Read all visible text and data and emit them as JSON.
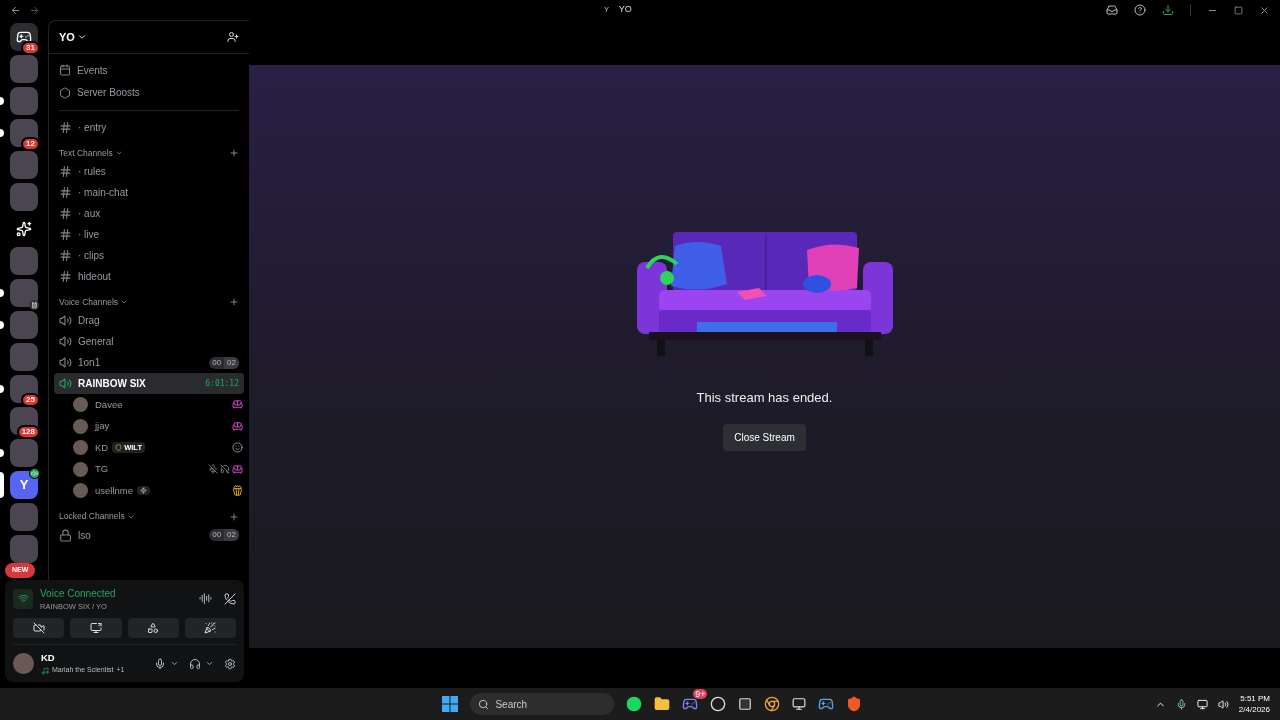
{
  "titlebar": {
    "server_letter": "Y",
    "title": "YO"
  },
  "servers": [
    {
      "kind": "home",
      "badge": "31",
      "unread": false,
      "selected": false,
      "paused": false,
      "voice": false
    },
    {
      "kind": "photo",
      "unread": false,
      "selected": false,
      "paused": false,
      "voice": false
    },
    {
      "kind": "photo",
      "unread": true,
      "selected": false,
      "paused": false,
      "voice": false
    },
    {
      "kind": "photo",
      "badge": "12",
      "unread": true,
      "selected": false,
      "paused": false,
      "voice": false
    },
    {
      "kind": "photo",
      "unread": false,
      "selected": false,
      "paused": false,
      "voice": false
    },
    {
      "kind": "photo",
      "unread": false,
      "selected": false,
      "paused": false,
      "voice": false
    },
    {
      "kind": "sparkle",
      "unread": false,
      "selected": false,
      "paused": false,
      "voice": false
    },
    {
      "kind": "photo",
      "unread": false,
      "selected": false,
      "paused": false,
      "voice": false
    },
    {
      "kind": "photo",
      "unread": true,
      "selected": false,
      "paused": true,
      "voice": false
    },
    {
      "kind": "photo",
      "unread": true,
      "selected": false,
      "paused": false,
      "voice": false
    },
    {
      "kind": "photo",
      "unread": false,
      "selected": false,
      "paused": false,
      "voice": false
    },
    {
      "kind": "photo",
      "badge": "25",
      "unread": true,
      "selected": false,
      "paused": false,
      "voice": false
    },
    {
      "kind": "photo",
      "badge": "128",
      "unread": false,
      "selected": false,
      "paused": false,
      "voice": false
    },
    {
      "kind": "photo",
      "unread": true,
      "selected": false,
      "paused": false,
      "voice": false
    },
    {
      "kind": "letter",
      "letter": "Y",
      "unread": false,
      "selected": true,
      "paused": false,
      "voice": true
    },
    {
      "kind": "photo",
      "unread": false,
      "selected": false,
      "paused": false,
      "voice": false
    },
    {
      "kind": "photo",
      "unread": false,
      "selected": false,
      "paused": false,
      "voice": false
    }
  ],
  "new_badge": "NEW",
  "server": {
    "name": "YO"
  },
  "menu": [
    {
      "kind": "events",
      "label": "Events"
    },
    {
      "kind": "boosts",
      "label": "Server Boosts"
    }
  ],
  "top_channels": [
    {
      "name": "· entry"
    }
  ],
  "categories": [
    {
      "name": "Text Channels",
      "kind": "text",
      "channels": [
        {
          "name": "· rules"
        },
        {
          "name": "· main-chat"
        },
        {
          "name": "· aux"
        },
        {
          "name": "· live"
        },
        {
          "name": "· clips"
        },
        {
          "name": "hideout"
        }
      ]
    },
    {
      "name": "Voice Channels",
      "kind": "voice",
      "channels": [
        {
          "name": "Drag",
          "selected": false
        },
        {
          "name": "General",
          "selected": false
        },
        {
          "name": "1on1",
          "selected": false,
          "counter": [
            "00",
            "02"
          ]
        },
        {
          "name": "RAINBOW SIX",
          "selected": true,
          "timer": "6:01:12",
          "users": [
            {
              "name": "Davee",
              "muted": false,
              "deafened": false,
              "kind": "couch"
            },
            {
              "name": "jjay",
              "muted": false,
              "deafened": false,
              "kind": "couch"
            },
            {
              "name": "KD",
              "muted": false,
              "deafened": false,
              "kind": "emoji",
              "tag": {
                "kind": "guild",
                "text": "WILT"
              }
            },
            {
              "name": "TG",
              "muted": true,
              "deafened": true,
              "kind": "couch"
            },
            {
              "name": "usellnme",
              "muted": false,
              "deafened": false,
              "kind": "popcorn",
              "tag": {
                "kind": "bolt"
              }
            }
          ]
        }
      ]
    },
    {
      "name": "Locked Channels",
      "kind": "locked",
      "channels": [
        {
          "name": "lso",
          "selected": false,
          "counter": [
            "00",
            "02"
          ]
        }
      ]
    }
  ],
  "voice_panel": {
    "status": "Voice Connected",
    "location": "RAINBOW SIX / YO"
  },
  "user": {
    "name": "KD",
    "song": "Mariah the Scientist",
    "extra": "+1"
  },
  "stream": {
    "message": "This stream has ended.",
    "button": "Close Stream"
  },
  "taskbar": {
    "search_placeholder": "Search",
    "discord_badge": "9+",
    "time": "5:51 PM",
    "date": "2/4/2026"
  }
}
